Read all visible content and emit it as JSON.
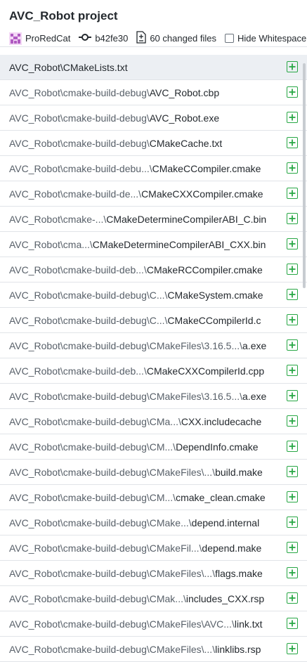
{
  "header": {
    "title": "AVC_Robot project",
    "author": "ProRedCat",
    "commit_sha": "b42fe30",
    "changed_files": "60 changed files",
    "hide_whitespace": "Hide Whitespace",
    "avatar_icon": "user-avatar-icon",
    "commit_icon": "commit-icon",
    "files_icon": "diff-files-icon"
  },
  "colors": {
    "added": "#28a745",
    "selected_row": "#eceff3"
  },
  "files": [
    {
      "dir": "AVC_Robot\\",
      "name": "CMakeLists.txt",
      "status": "added"
    },
    {
      "dir": "AVC_Robot\\cmake-build-debug\\",
      "name": "AVC_Robot.cbp",
      "status": "added"
    },
    {
      "dir": "AVC_Robot\\cmake-build-debug\\",
      "name": "AVC_Robot.exe",
      "status": "added"
    },
    {
      "dir": "AVC_Robot\\cmake-build-debug\\",
      "name": "CMakeCache.txt",
      "status": "added"
    },
    {
      "dir": "AVC_Robot\\cmake-build-debu...\\",
      "name": "CMakeCCompiler.cmake",
      "status": "added"
    },
    {
      "dir": "AVC_Robot\\cmake-build-de...\\",
      "name": "CMakeCXXCompiler.cmake",
      "status": "added"
    },
    {
      "dir": "AVC_Robot\\cmake-...\\",
      "name": "CMakeDetermineCompilerABI_C.bin",
      "status": "added"
    },
    {
      "dir": "AVC_Robot\\cma...\\",
      "name": "CMakeDetermineCompilerABI_CXX.bin",
      "status": "added"
    },
    {
      "dir": "AVC_Robot\\cmake-build-deb...\\",
      "name": "CMakeRCCompiler.cmake",
      "status": "added"
    },
    {
      "dir": "AVC_Robot\\cmake-build-debug\\C...\\",
      "name": "CMakeSystem.cmake",
      "status": "added"
    },
    {
      "dir": "AVC_Robot\\cmake-build-debug\\C...\\",
      "name": "CMakeCCompilerId.c",
      "status": "added"
    },
    {
      "dir": "AVC_Robot\\cmake-build-debug\\CMakeFiles\\3.16.5...\\",
      "name": "a.exe",
      "status": "added"
    },
    {
      "dir": "AVC_Robot\\cmake-build-deb...\\",
      "name": "CMakeCXXCompilerId.cpp",
      "status": "added"
    },
    {
      "dir": "AVC_Robot\\cmake-build-debug\\CMakeFiles\\3.16.5...\\",
      "name": "a.exe",
      "status": "added"
    },
    {
      "dir": "AVC_Robot\\cmake-build-debug\\CMa...\\",
      "name": "CXX.includecache",
      "status": "added"
    },
    {
      "dir": "AVC_Robot\\cmake-build-debug\\CM...\\",
      "name": "DependInfo.cmake",
      "status": "added"
    },
    {
      "dir": "AVC_Robot\\cmake-build-debug\\CMakeFiles\\...\\",
      "name": "build.make",
      "status": "added"
    },
    {
      "dir": "AVC_Robot\\cmake-build-debug\\CM...\\",
      "name": "cmake_clean.cmake",
      "status": "added"
    },
    {
      "dir": "AVC_Robot\\cmake-build-debug\\CMake...\\",
      "name": "depend.internal",
      "status": "added"
    },
    {
      "dir": "AVC_Robot\\cmake-build-debug\\CMakeFil...\\",
      "name": "depend.make",
      "status": "added"
    },
    {
      "dir": "AVC_Robot\\cmake-build-debug\\CMakeFiles\\...\\",
      "name": "flags.make",
      "status": "added"
    },
    {
      "dir": "AVC_Robot\\cmake-build-debug\\CMak...\\",
      "name": "includes_CXX.rsp",
      "status": "added"
    },
    {
      "dir": "AVC_Robot\\cmake-build-debug\\CMakeFiles\\AVC...\\",
      "name": "link.txt",
      "status": "added"
    },
    {
      "dir": "AVC_Robot\\cmake-build-debug\\CMakeFiles\\...\\",
      "name": "linklibs.rsp",
      "status": "added"
    }
  ]
}
